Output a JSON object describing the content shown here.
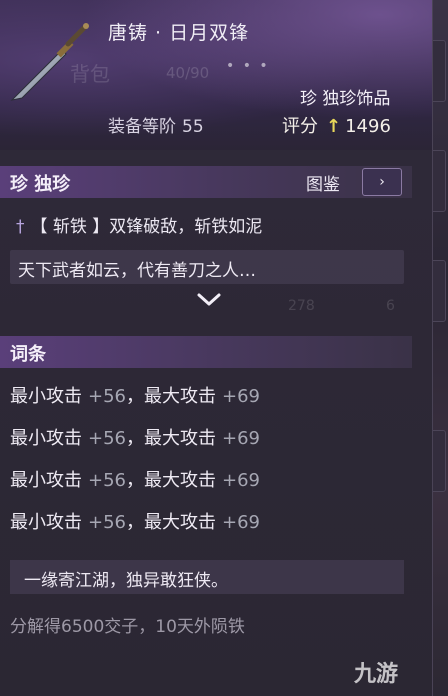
{
  "item": {
    "name": "唐铸 · 日月双锋",
    "bag_label": "背包",
    "bag_capacity": "40/90",
    "rarity_tag": "珍 独珍饰品",
    "equip_level_label": "装备等阶",
    "equip_level": "55",
    "score_label": "评分",
    "score": "1496"
  },
  "rarity_section": {
    "title": "珍 独珍",
    "catalog_label": "图鉴",
    "catalog_icon": "›"
  },
  "skill": {
    "text": "【 斩铁 】双锋破敌，斩铁如泥"
  },
  "flavor_text": "天下武者如云，代有善刀之人…",
  "background_numbers": [
    "278",
    "6"
  ],
  "affix_section": {
    "title": "词条"
  },
  "affixes": [
    {
      "min_label": "最小攻击",
      "min_value": "+56",
      "max_label": "最大攻击",
      "max_value": "+69"
    },
    {
      "min_label": "最小攻击",
      "min_value": "+56",
      "max_label": "最大攻击",
      "max_value": "+69"
    },
    {
      "min_label": "最小攻击",
      "min_value": "+56",
      "max_label": "最大攻击",
      "max_value": "+69"
    },
    {
      "min_label": "最小攻击",
      "min_value": "+56",
      "max_label": "最大攻击",
      "max_value": "+69"
    }
  ],
  "motto": "一缘寄江湖，独异敢狂侠。",
  "decompose_text": "分解得6500交子，10天外陨铁",
  "watermark": "九游",
  "colors": {
    "section_bar": "#5a3f7a",
    "score_arrow": "#e8d75a",
    "affix_value": "#a6a7b3"
  }
}
